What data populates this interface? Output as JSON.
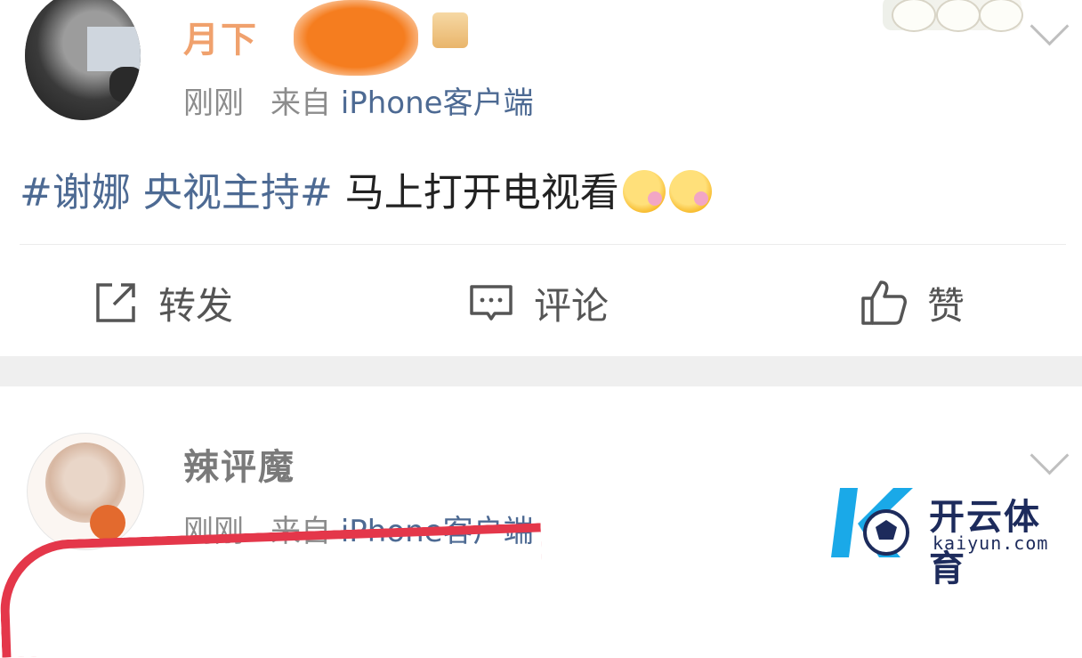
{
  "post1": {
    "username": "月下",
    "time": "刚刚",
    "source_prefix": "来自",
    "source": "iPhone客户端",
    "topic": "#谢娜 央视主持#",
    "text": " 马上打开电视看",
    "emoji_icon": "flower-face-emoji-icon",
    "actions": {
      "repost": "转发",
      "comment": "评论",
      "like": "赞"
    }
  },
  "post2": {
    "username": "辣评魔",
    "time": "刚刚",
    "source_prefix": "来自",
    "source": "iPhone客户端"
  },
  "watermark": {
    "name": "开云体育",
    "url": "kaiyun.com"
  },
  "colors": {
    "link_blue": "#4d6a93",
    "meta_gray": "#8c8c8c",
    "separator_gray": "#efefef",
    "annotation_red": "#e4374a"
  }
}
